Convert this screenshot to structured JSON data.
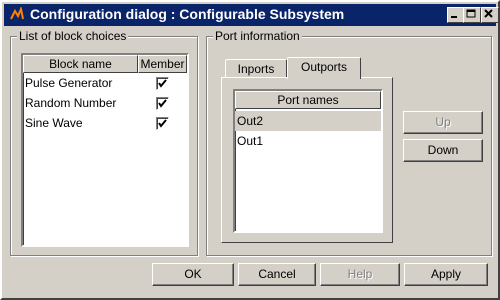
{
  "window": {
    "title": "Configuration dialog : Configurable Subsystem"
  },
  "block_choices": {
    "legend": "List of block choices",
    "columns": {
      "name": "Block name",
      "member": "Member"
    },
    "rows": [
      {
        "name": "Pulse Generator",
        "member": true
      },
      {
        "name": "Random Number",
        "member": true
      },
      {
        "name": "Sine Wave",
        "member": true
      }
    ]
  },
  "port_info": {
    "legend": "Port information",
    "tabs": [
      {
        "label": "Inports",
        "active": false
      },
      {
        "label": "Outports",
        "active": true
      }
    ],
    "list_header": "Port names",
    "ports": [
      {
        "name": "Out2",
        "selected": true
      },
      {
        "name": "Out1",
        "selected": false
      }
    ],
    "up_label": "Up",
    "down_label": "Down"
  },
  "footer": {
    "ok_label": "OK",
    "cancel_label": "Cancel",
    "help_label": "Help",
    "apply_label": "Apply"
  }
}
